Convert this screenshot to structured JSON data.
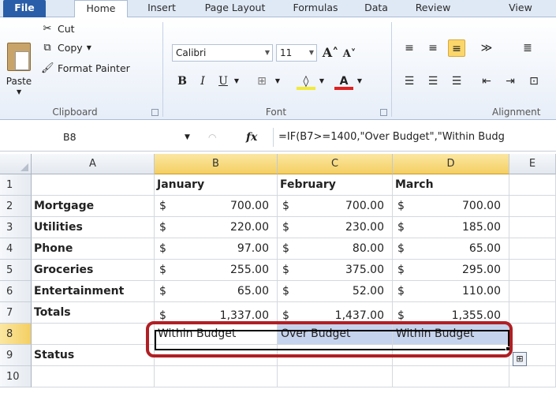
{
  "tabs": [
    "File",
    "Home",
    "Insert",
    "Page Layout",
    "Formulas",
    "Data",
    "Review",
    "View"
  ],
  "clipboard": {
    "paste_label": "Paste",
    "cut_label": "Cut",
    "copy_label": "Copy",
    "format_painter_label": "Format Painter",
    "group_label": "Clipboard"
  },
  "font": {
    "name": "Calibri",
    "size": "11",
    "group_label": "Font"
  },
  "alignment": {
    "group_label": "Alignment"
  },
  "formula_bar": {
    "name_box": "B8",
    "fx_label": "fx",
    "formula": "=IF(B7>=1400,\"Over Budget\",\"Within Budg"
  },
  "grid": {
    "columns": [
      "A",
      "B",
      "C",
      "D",
      "E"
    ],
    "rows": [
      "1",
      "2",
      "3",
      "4",
      "5",
      "6",
      "7",
      "8",
      "9",
      "10"
    ],
    "headers": [
      "January",
      "February",
      "March"
    ],
    "currency": "$",
    "data": [
      {
        "label": "Mortgage",
        "values": [
          "700.00",
          "700.00",
          "700.00"
        ]
      },
      {
        "label": "Utilities",
        "values": [
          "220.00",
          "230.00",
          "185.00"
        ]
      },
      {
        "label": "Phone",
        "values": [
          "97.00",
          "80.00",
          "65.00"
        ]
      },
      {
        "label": "Groceries",
        "values": [
          "255.00",
          "375.00",
          "295.00"
        ]
      },
      {
        "label": "Entertainment",
        "values": [
          "65.00",
          "52.00",
          "110.00"
        ]
      },
      {
        "label": "Totals",
        "values": [
          "1,337.00",
          "1,437.00",
          "1,355.00"
        ]
      }
    ],
    "row8": [
      "Within Budget",
      "Over Budget",
      "Within Budget"
    ],
    "row9_label": "Status"
  }
}
